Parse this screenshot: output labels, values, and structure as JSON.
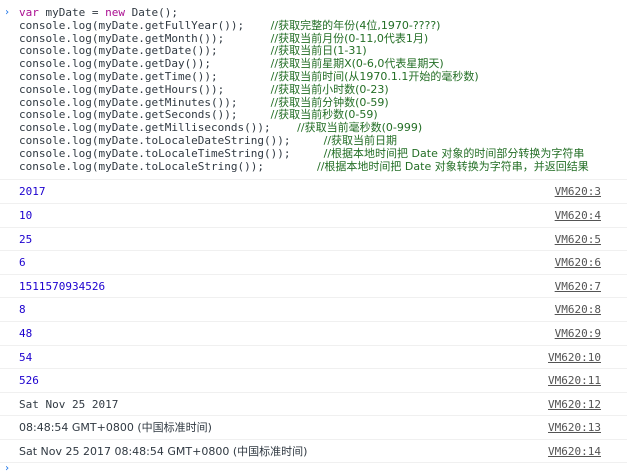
{
  "input": {
    "lines": [
      {
        "code": "var myDate = new Date();",
        "comment": ""
      },
      {
        "code": "console.log(myDate.getFullYear());    ",
        "comment": "//获取完整的年份(4位,1970-????)"
      },
      {
        "code": "console.log(myDate.getMonth());       ",
        "comment": "//获取当前月份(0-11,0代表1月)"
      },
      {
        "code": "console.log(myDate.getDate());        ",
        "comment": "//获取当前日(1-31)"
      },
      {
        "code": "console.log(myDate.getDay());         ",
        "comment": "//获取当前星期X(0-6,0代表星期天)"
      },
      {
        "code": "console.log(myDate.getTime());        ",
        "comment": "//获取当前时间(从1970.1.1开始的毫秒数)"
      },
      {
        "code": "console.log(myDate.getHours());       ",
        "comment": "//获取当前小时数(0-23)"
      },
      {
        "code": "console.log(myDate.getMinutes());     ",
        "comment": "//获取当前分钟数(0-59)"
      },
      {
        "code": "console.log(myDate.getSeconds());     ",
        "comment": "//获取当前秒数(0-59)"
      },
      {
        "code": "console.log(myDate.getMilliseconds());    ",
        "comment": "//获取当前毫秒数(0-999)"
      },
      {
        "code": "console.log(myDate.toLocaleDateString());     ",
        "comment": "//获取当前日期"
      },
      {
        "code": "console.log(myDate.toLocaleTimeString());     ",
        "comment": "//根据本地时间把 Date 对象的时间部分转换为字符串"
      },
      {
        "code": "console.log(myDate.toLocaleString());        ",
        "comment": "//根据本地时间把 Date 对象转换为字符串，并返回结果"
      }
    ]
  },
  "outputs": [
    {
      "value": "2017",
      "kind": "num",
      "source": "VM620:3"
    },
    {
      "value": "10",
      "kind": "num",
      "source": "VM620:4"
    },
    {
      "value": "25",
      "kind": "num",
      "source": "VM620:5"
    },
    {
      "value": "6",
      "kind": "num",
      "source": "VM620:6"
    },
    {
      "value": "1511570934526",
      "kind": "num",
      "source": "VM620:7"
    },
    {
      "value": "8",
      "kind": "num",
      "source": "VM620:8"
    },
    {
      "value": "48",
      "kind": "num",
      "source": "VM620:9"
    },
    {
      "value": "54",
      "kind": "num",
      "source": "VM620:10"
    },
    {
      "value": "526",
      "kind": "num",
      "source": "VM620:11"
    },
    {
      "value": "Sat Nov 25 2017",
      "kind": "str",
      "source": "VM620:12"
    },
    {
      "value": "08:48:54 GMT+0800 (中国标准时间)",
      "kind": "str",
      "source": "VM620:13"
    },
    {
      "value": "Sat Nov 25 2017 08:48:54 GMT+0800 (中国标准时间)",
      "kind": "str",
      "source": "VM620:14"
    }
  ],
  "colors": {
    "keyword": "#aa0d91",
    "comment": "#236e25",
    "number": "#1c00cf",
    "text": "#303942",
    "link": "#545454",
    "prompt": "#1a73e8"
  },
  "icons": {
    "prompt": "chevron-right-icon"
  }
}
